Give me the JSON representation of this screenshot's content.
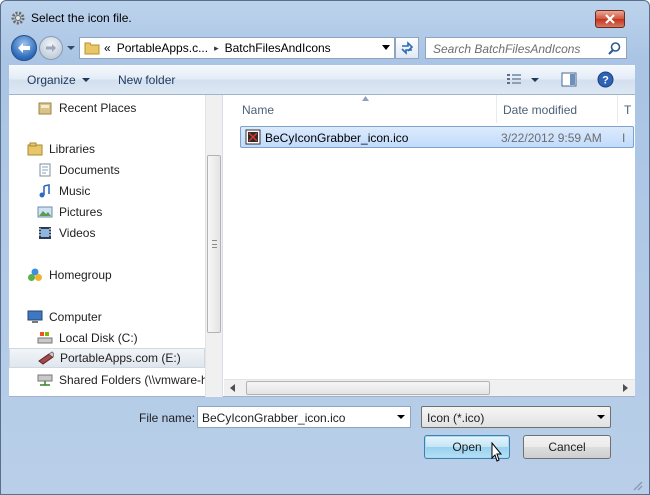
{
  "window": {
    "title": "Select the icon file."
  },
  "address": {
    "overflow_marker": "«",
    "segments": [
      "PortableApps.c...",
      "BatchFilesAndIcons"
    ],
    "separator": "▸"
  },
  "search": {
    "placeholder": "Search BatchFilesAndIcons"
  },
  "toolbar": {
    "organize_label": "Organize",
    "new_folder_label": "New folder"
  },
  "nav": {
    "items": [
      {
        "label": "Recent Places",
        "icon": "recent-places-icon"
      },
      {
        "label": "Libraries",
        "icon": "libraries-icon"
      },
      {
        "label": "Documents",
        "icon": "documents-icon"
      },
      {
        "label": "Music",
        "icon": "music-icon"
      },
      {
        "label": "Pictures",
        "icon": "pictures-icon"
      },
      {
        "label": "Videos",
        "icon": "videos-icon"
      },
      {
        "label": "Homegroup",
        "icon": "homegroup-icon"
      },
      {
        "label": "Computer",
        "icon": "computer-icon"
      },
      {
        "label": "Local Disk (C:)",
        "icon": "local-disk-icon"
      },
      {
        "label": "PortableApps.com (E:)",
        "icon": "usb-drive-icon"
      },
      {
        "label": "Shared Folders (\\\\vmware-h",
        "icon": "network-drive-icon"
      }
    ],
    "selected": "PortableApps.com (E:)"
  },
  "columns": {
    "name": "Name",
    "date_modified": "Date modified",
    "type": "T"
  },
  "files": [
    {
      "name": "BeCyIconGrabber_icon.ico",
      "date_modified": "3/22/2012 9:59 AM",
      "type": "I"
    }
  ],
  "bottom": {
    "file_name_label": "File name:",
    "file_name_value": "BeCyIconGrabber_icon.ico",
    "filter_value": "Icon (*.ico)",
    "open_label": "Open",
    "cancel_label": "Cancel"
  },
  "colors": {
    "selection": "#c1dbfc",
    "close": "#c7432b",
    "accent": "#1e395b"
  }
}
